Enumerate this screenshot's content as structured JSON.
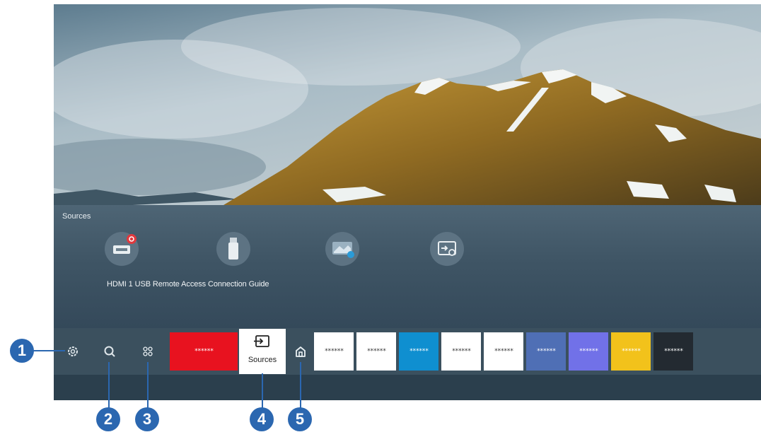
{
  "sources_panel": {
    "title": "Sources",
    "items_label_line": "HDMI 1 USB Remote Access Connection Guide",
    "items": [
      {
        "name": "HDMI 1",
        "icon": "hdmi-icon",
        "badge_color": "#e0393e"
      },
      {
        "name": "USB",
        "icon": "usb-drive-icon"
      },
      {
        "name": "Remote Access",
        "icon": "remote-access-icon"
      },
      {
        "name": "Connection Guide",
        "icon": "connection-guide-icon"
      }
    ]
  },
  "bottom_bar": {
    "buttons": [
      {
        "name": "settings",
        "icon": "gear-icon"
      },
      {
        "name": "search",
        "icon": "search-icon"
      },
      {
        "name": "apps",
        "icon": "apps-grid-icon"
      }
    ],
    "sources_card_label": "Sources",
    "home_icon": "home-icon",
    "apps": [
      {
        "text": "******",
        "bg": "#e8121f",
        "fg": "#ffffff"
      },
      {
        "text": "******",
        "bg": "#ffffff",
        "fg": "#333333"
      },
      {
        "text": "******",
        "bg": "#ffffff",
        "fg": "#333333"
      },
      {
        "text": "******",
        "bg": "#0f8fd0",
        "fg": "#ffffff"
      },
      {
        "text": "******",
        "bg": "#ffffff",
        "fg": "#333333"
      },
      {
        "text": "******",
        "bg": "#ffffff",
        "fg": "#333333"
      },
      {
        "text": "******",
        "bg": "#4f6fb5",
        "fg": "#ffffff"
      },
      {
        "text": "******",
        "bg": "#7171e8",
        "fg": "#ffffff"
      },
      {
        "text": "******",
        "bg": "#f2c21b",
        "fg": "#ffffff"
      },
      {
        "text": "******",
        "bg": "#232a31",
        "fg": "#ffffff"
      }
    ]
  },
  "callouts": [
    "1",
    "2",
    "3",
    "4",
    "5"
  ],
  "colors": {
    "callout": "#2b67b0",
    "bar": "#3b505e"
  }
}
